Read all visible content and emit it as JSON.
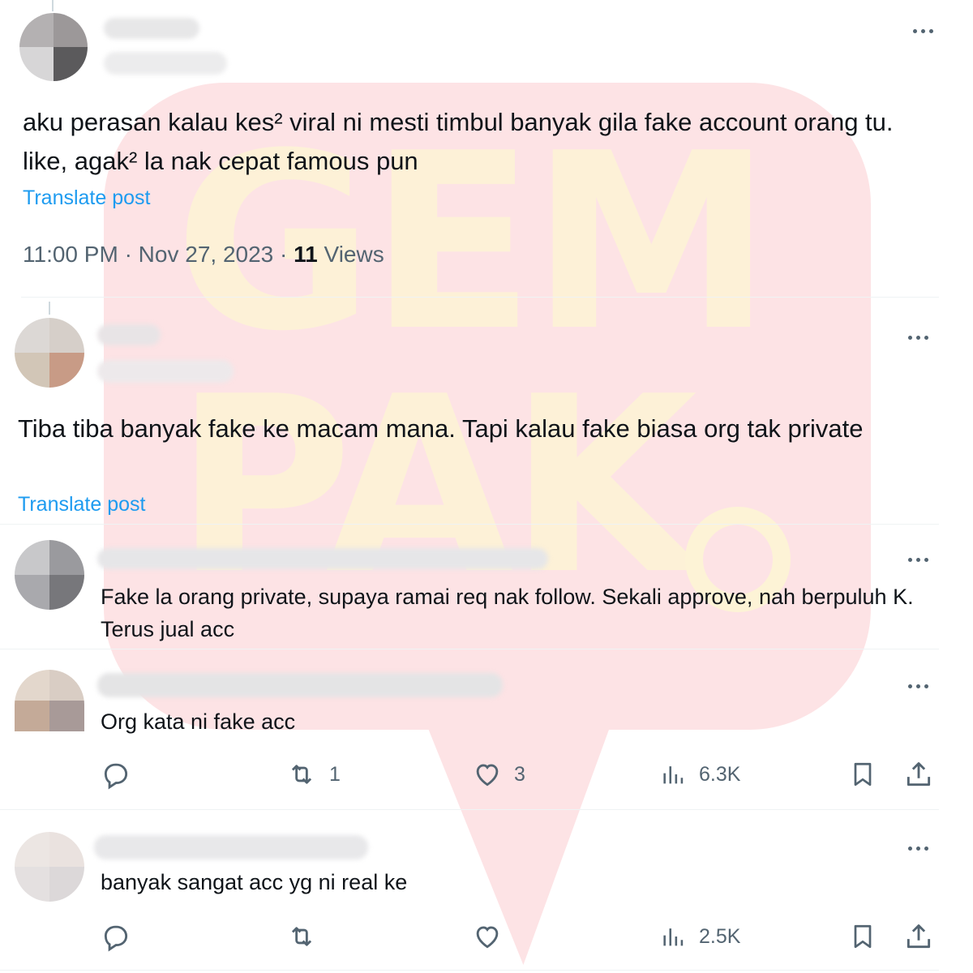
{
  "watermark": {
    "line1": "GEM",
    "line2": "PAK"
  },
  "tweet1": {
    "text": "aku perasan kalau kes² viral ni mesti timbul banyak gila fake account orang tu. like, agak² la nak cepat famous pun",
    "translate": "Translate post",
    "time": "11:00 PM",
    "date": "Nov 27, 2023",
    "views_count": "11",
    "views_label": "Views"
  },
  "tweet2": {
    "text": "Tiba tiba banyak fake ke macam mana. Tapi kalau fake biasa org tak private",
    "translate": "Translate post"
  },
  "reply1": {
    "text": "Fake la orang private, supaya ramai req nak follow. Sekali approve, nah berpuluh K. Terus jual acc"
  },
  "reply2": {
    "text": "Org kata ni fake acc",
    "retweets": "1",
    "likes": "3",
    "views": "6.3K"
  },
  "reply3": {
    "text": "banyak sangat acc yg ni real ke",
    "views": "2.5K"
  },
  "icons": [
    "more-icon",
    "reply-icon",
    "retweet-icon",
    "like-icon",
    "views-icon",
    "bookmark-icon",
    "share-icon"
  ],
  "colors": {
    "link": "#1d9bf0",
    "muted": "#536471",
    "text": "#0f1419"
  }
}
